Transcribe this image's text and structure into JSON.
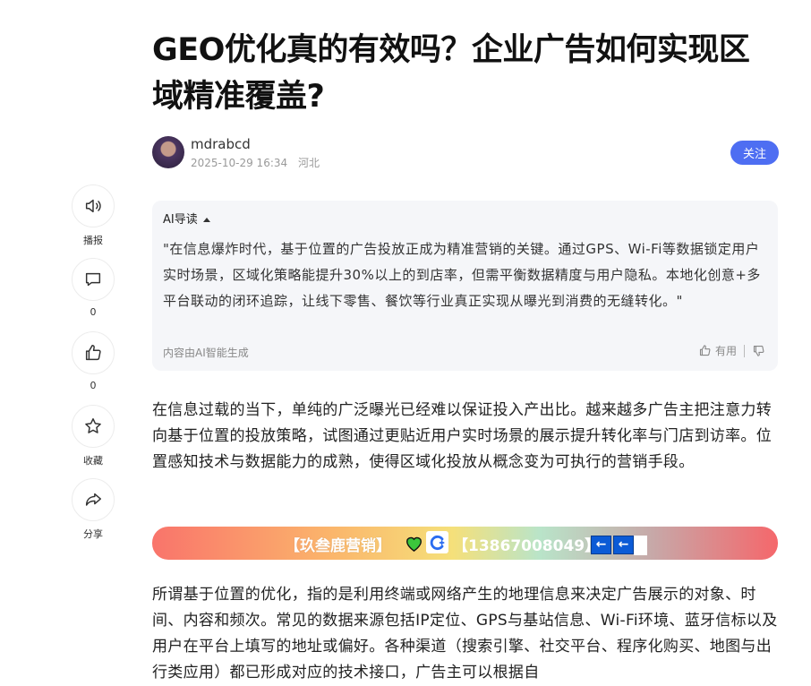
{
  "article": {
    "title": "GEO优化真的有效吗？企业广告如何实现区域精准覆盖?"
  },
  "author": {
    "name": "mdrabcd",
    "date": "2025-10-29 16:34",
    "location": "河北",
    "follow_label": "关注"
  },
  "sidebar": {
    "items": [
      {
        "label": "播报",
        "icon": "speaker-icon"
      },
      {
        "label": "0",
        "icon": "comment-icon"
      },
      {
        "label": "0",
        "icon": "thumbs-up-icon"
      },
      {
        "label": "收藏",
        "icon": "star-icon"
      },
      {
        "label": "分享",
        "icon": "share-icon"
      }
    ]
  },
  "ai_summary": {
    "heading": "AI导读",
    "text": "\"在信息爆炸时代，基于位置的广告投放正成为精准营销的关键。通过GPS、Wi-Fi等数据锁定用户实时场景，区域化策略能提升30%以上的到店率，但需平衡数据精度与用户隐私。本地化创意+多平台联动的闭环追踪，让线下零售、餐饮等行业真正实现从曝光到消费的无缝转化。\"",
    "footer": "内容由AI智能生成",
    "useful_label": "有用"
  },
  "paragraphs": [
    "在信息过载的当下，单纯的广泛曝光已经难以保证投入产出比。越来越多广告主把注意力转向基于位置的投放策略，试图通过更贴近用户实时场景的展示提升转化率与门店到访率。位置感知技术与数据能力的成熟，使得区域化投放从概念变为可执行的营销手段。",
    "所谓基于位置的优化，指的是利用终端或网络产生的地理信息来决定广告展示的对象、时间、内容和频次。常见的数据来源包括IP定位、GPS与基站信息、Wi-Fi环境、蓝牙信标以及用户在平台上填写的地址或偏好。各种渠道（搜索引擎、社交平台、程序化购买、地图与出行类应用）都已形成对应的技术接口，广告主可以根据自"
  ],
  "banner": {
    "name_text": "【玖叁鹿营销】",
    "phone_text": "【13867008049】",
    "arrow": "←"
  },
  "colors": {
    "accent": "#4e6ef2",
    "ai_bg": "#f5f6f9",
    "arrow_box": "#0b5bd6"
  }
}
